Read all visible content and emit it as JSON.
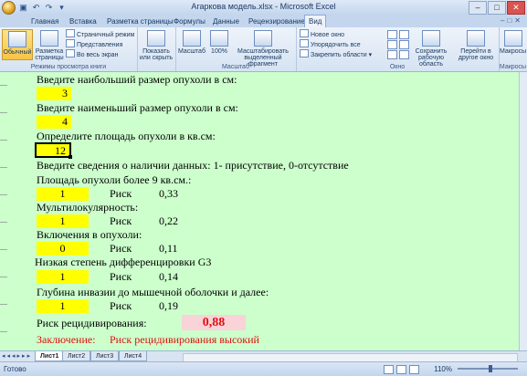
{
  "window": {
    "title": "Агаркова модель.xlsx - Microsoft Excel"
  },
  "tabs": [
    "Главная",
    "Вставка",
    "Разметка страницы",
    "Формулы",
    "Данные",
    "Рецензирование",
    "Вид"
  ],
  "active_tab": "Вид",
  "ribbon": {
    "view_modes": {
      "normal": "Обычный",
      "page_layout_1": "Разметка",
      "page_layout_2": "страницы",
      "page_mode": "Страничный режим",
      "views": "Представления",
      "fullscreen": "Во весь экран",
      "group_label": "Режимы просмотра книги"
    },
    "show_hide": {
      "label_1": "Показать",
      "label_2": "или скрыть"
    },
    "zoom": {
      "zoom": "Масштаб",
      "hundred": "100%",
      "fit_1": "Масштабировать",
      "fit_2": "выделенный фрагмент",
      "group_label": "Масштаб"
    },
    "window": {
      "new": "Новое окно",
      "arrange": "Упорядочить все",
      "freeze": "Закрепить области",
      "save_1": "Сохранить",
      "save_2": "рабочую область",
      "switch_1": "Перейти в",
      "switch_2": "другое окно",
      "group_label": "Окно"
    },
    "macros": {
      "label": "Макросы",
      "group_label": "Макросы"
    }
  },
  "sheet": {
    "q1": "Введите наибольший размер опухоли в см:",
    "v1": "3",
    "q2": "Введите наименьший размер опухоли в см:",
    "v2": "4",
    "q3": "Определите площадь опухоли в кв.см:",
    "v3": "12",
    "instructions": "Введите сведения о наличии данных: 1- присутствие, 0-отсутствие",
    "risk_word": "Риск",
    "factors": [
      {
        "label": "Площадь опухоли более 9 кв.см.:",
        "value": "1",
        "risk": "0,33"
      },
      {
        "label": "Мультилокулярность:",
        "value": "1",
        "risk": "0,22"
      },
      {
        "label": "Включения в опухоли:",
        "value": "0",
        "risk": "0,11"
      },
      {
        "label": "Низкая степень дифференцировки G3",
        "value": "1",
        "risk": "0,14"
      },
      {
        "label": "Глубина инвазии до мышечной оболочки и далее:",
        "value": "1",
        "risk": "0,19"
      }
    ],
    "recurrence_label": "Риск рецидивирования:",
    "recurrence_value": "0,88",
    "conclusion_label": "Заключение:",
    "conclusion_value": "Риск рецидивирования высокий"
  },
  "sheet_tabs": [
    "Лист1",
    "Лист2",
    "Лист3",
    "Лист4"
  ],
  "status": {
    "ready": "Готово",
    "zoom": "110%"
  },
  "colors": {
    "cell_bg": "#ccffcc",
    "input": "#ffff00",
    "result_bg": "#f9d3d8",
    "alert": "#e01010"
  }
}
